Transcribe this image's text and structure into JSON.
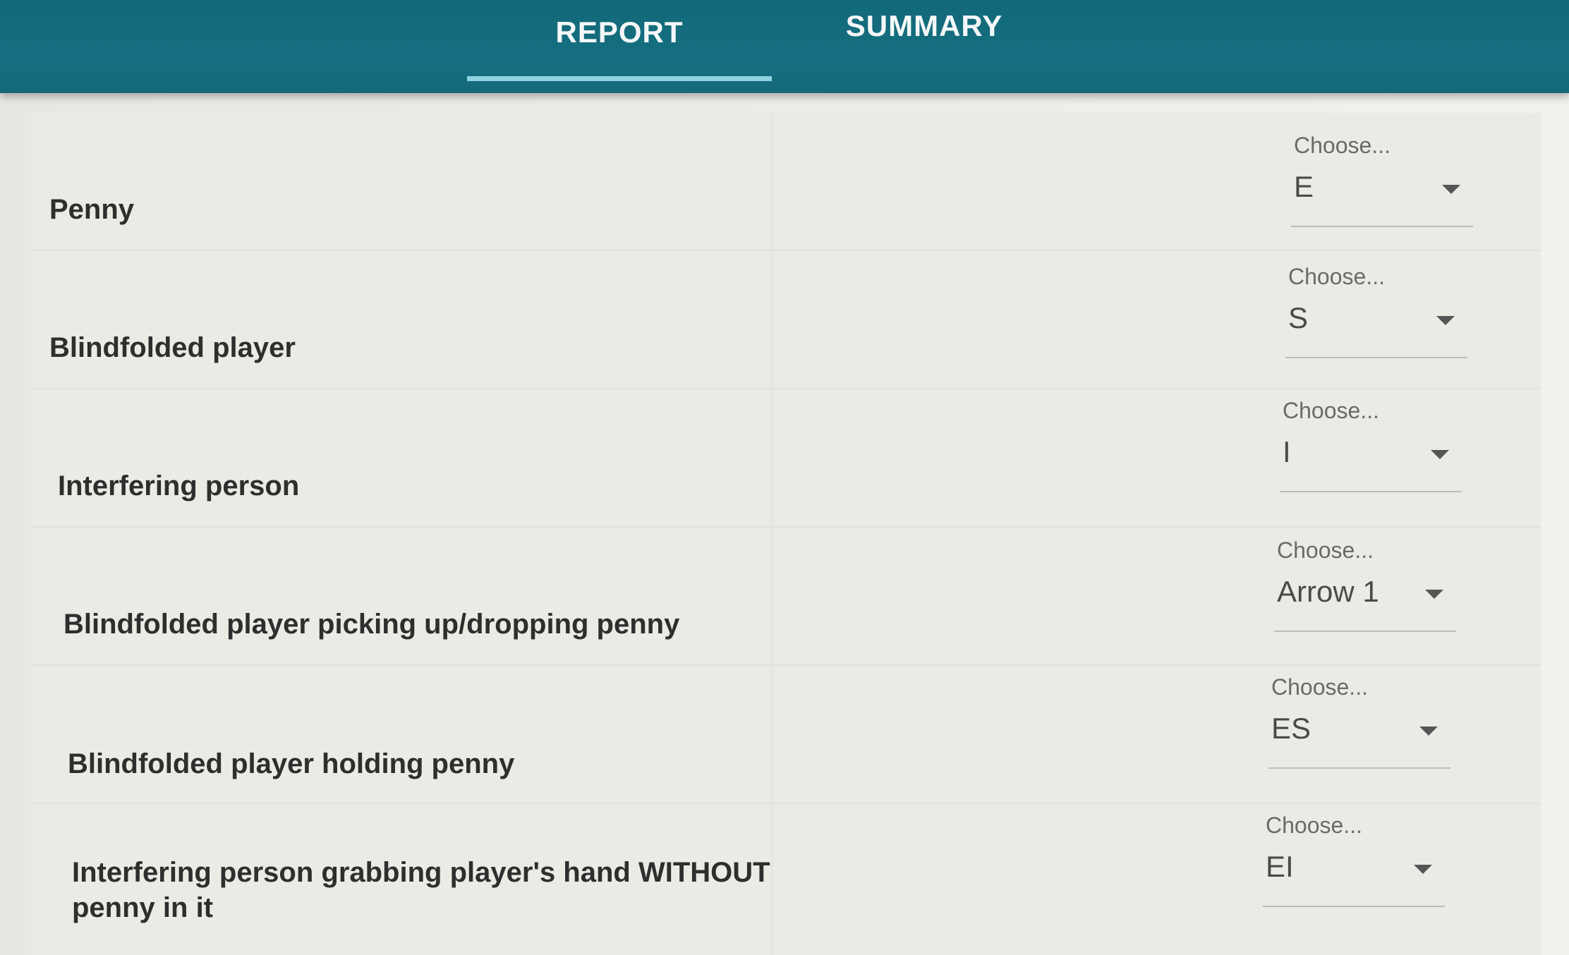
{
  "tabs": [
    {
      "label": "REPORT",
      "active": true
    },
    {
      "label": "SUMMARY",
      "active": false
    }
  ],
  "colors": {
    "header": "#156f80",
    "tab_indicator": "#8fd3e0",
    "text": "#2e2e2e"
  },
  "rows": [
    {
      "label": "Penny",
      "select": {
        "hint": "Choose...",
        "value": "E"
      }
    },
    {
      "label": "Blindfolded player",
      "select": {
        "hint": "Choose...",
        "value": "S"
      }
    },
    {
      "label": "Interfering person",
      "select": {
        "hint": "Choose...",
        "value": "I"
      }
    },
    {
      "label": "Blindfolded player picking up/dropping penny",
      "select": {
        "hint": "Choose...",
        "value": "Arrow 1"
      }
    },
    {
      "label": "Blindfolded player holding penny",
      "select": {
        "hint": "Choose...",
        "value": "ES"
      }
    },
    {
      "label": "Interfering person grabbing player's hand WITHOUT penny in it",
      "select": {
        "hint": "Choose...",
        "value": "EI"
      }
    }
  ],
  "icons": {
    "dropdown": "caret-down-icon"
  }
}
